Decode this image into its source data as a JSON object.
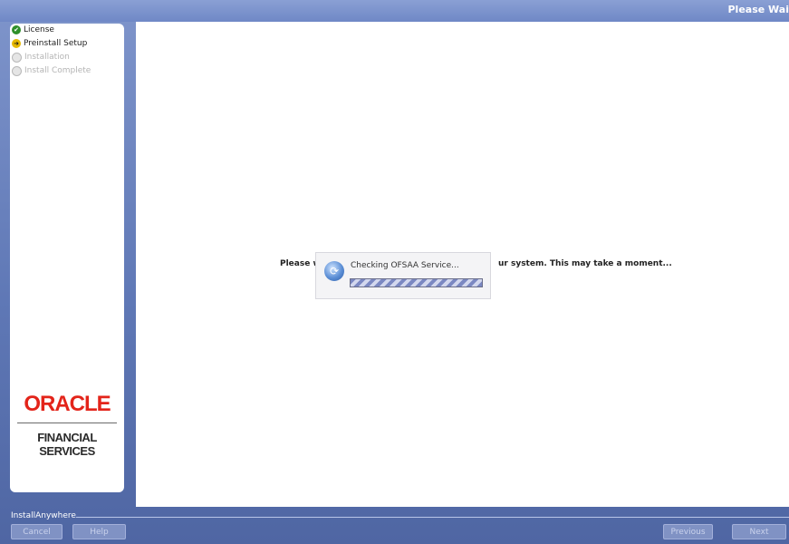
{
  "window": {
    "title": "Please Wai"
  },
  "sidebar": {
    "steps": [
      {
        "label": "License",
        "state": "done"
      },
      {
        "label": "Preinstall Setup",
        "state": "current"
      },
      {
        "label": "Installation",
        "state": "pending"
      },
      {
        "label": "Install Complete",
        "state": "pending"
      }
    ],
    "logo": {
      "brand": "ORACLE",
      "product": "FINANCIAL SERVICES"
    }
  },
  "main": {
    "message_left": "Please w",
    "message_right": "ur system.  This may take a moment..."
  },
  "progress_dialog": {
    "label": "Checking OFSAA Service...",
    "progress": "indeterminate"
  },
  "footer": {
    "installer_label": "InstallAnywhere",
    "cancel_label": "Cancel",
    "help_label": "Help",
    "previous_label": "Previous",
    "next_label": "Next"
  },
  "colors": {
    "background": "#6f84bd",
    "panel": "#ffffff",
    "oracle_red": "#e3241a",
    "done": "#2f8f2a",
    "current": "#e6b800"
  }
}
